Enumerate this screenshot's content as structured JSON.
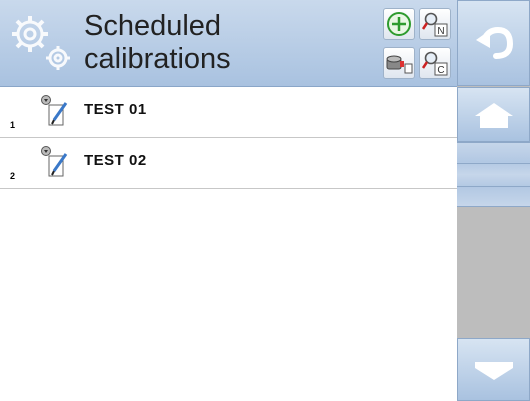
{
  "header": {
    "title_line1": "Scheduled",
    "title_line2": "calibrations",
    "buttons": {
      "add": "add-icon",
      "search_name": "search-N-icon",
      "filter": "filter-icon",
      "search_code": "search-C-icon"
    },
    "search_name_letter": "N",
    "search_code_letter": "C"
  },
  "sidebar": {
    "back": "back-arrow-icon",
    "home": "home-icon",
    "down": "arrow-down-icon"
  },
  "list": {
    "items": [
      {
        "index": "1",
        "label": "TEST 01",
        "icon": "calibration-edit-icon"
      },
      {
        "index": "2",
        "label": "TEST 02",
        "icon": "calibration-edit-icon"
      }
    ]
  },
  "colors": {
    "header": "#b3c9e4",
    "sidebar": "#bdbdbd",
    "accent_green": "#2e9b2e"
  }
}
